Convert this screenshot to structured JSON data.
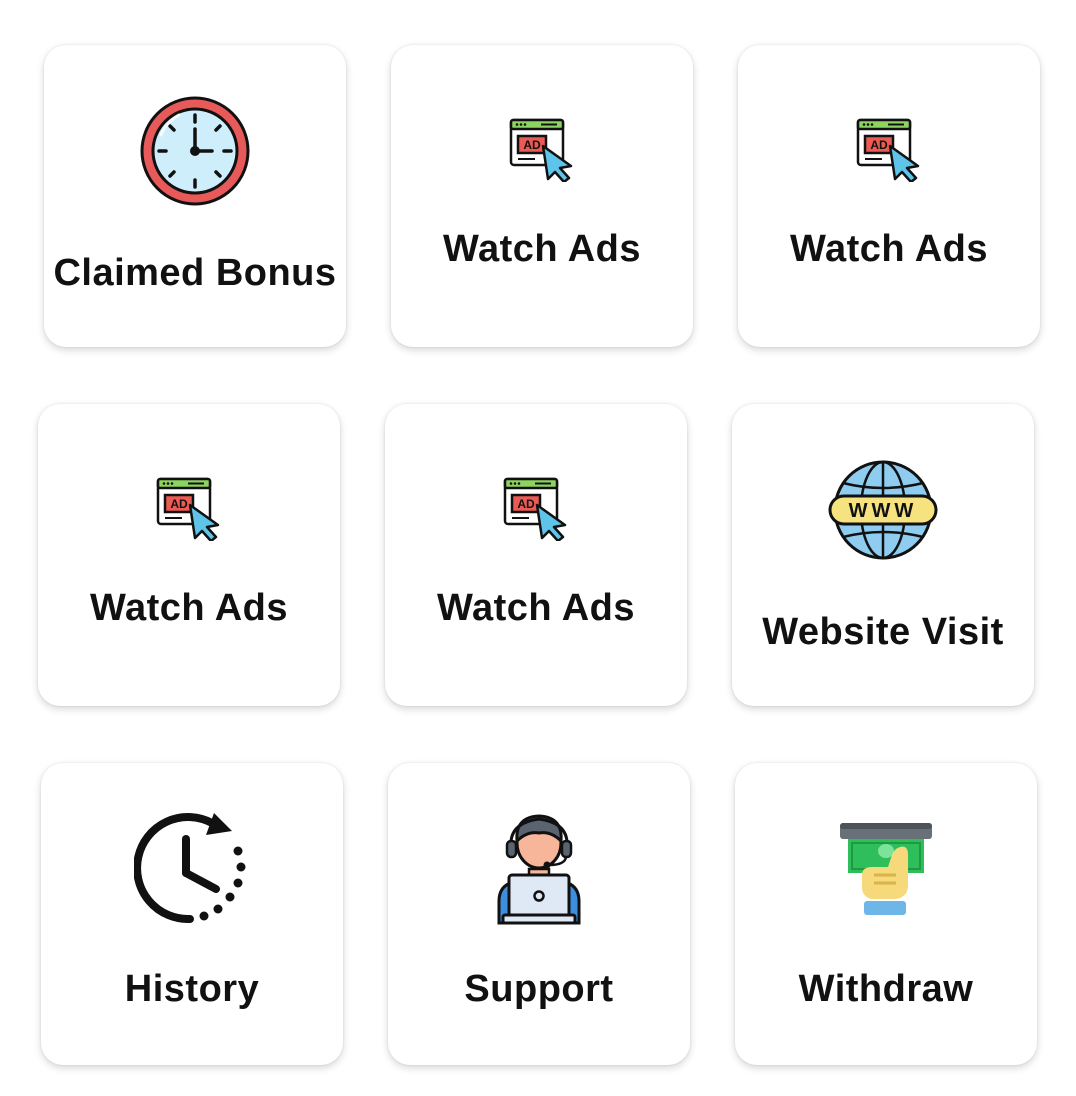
{
  "grid": {
    "tiles": [
      {
        "label": "Claimed Bonus",
        "icon": "clock-icon"
      },
      {
        "label": "Watch Ads",
        "icon": "ad-click-icon"
      },
      {
        "label": "Watch Ads",
        "icon": "ad-click-icon"
      },
      {
        "label": "Watch Ads",
        "icon": "ad-click-icon"
      },
      {
        "label": "Watch Ads",
        "icon": "ad-click-icon"
      },
      {
        "label": "Website Visit",
        "icon": "globe-www-icon",
        "badge": "WWW"
      },
      {
        "label": "History",
        "icon": "history-icon"
      },
      {
        "label": "Support",
        "icon": "support-agent-icon"
      },
      {
        "label": "Withdraw",
        "icon": "cash-withdraw-icon"
      }
    ],
    "ad_badge": "AD"
  },
  "colors": {
    "clock_ring": "#e85a5a",
    "clock_face": "#cdeefa",
    "ad_red": "#ec5b53",
    "ad_green": "#8dd35f",
    "cursor_blue": "#5fc4ea",
    "globe_blue": "#8ecdf0",
    "globe_band": "#f6e27f",
    "cash_green": "#2fbf5a",
    "hand_yellow": "#f5d97a",
    "cuff_blue": "#6fb6e8",
    "laptop_gray": "#dfe8f5",
    "agent_blue": "#3e8ee0",
    "skin": "#f7b59a"
  }
}
